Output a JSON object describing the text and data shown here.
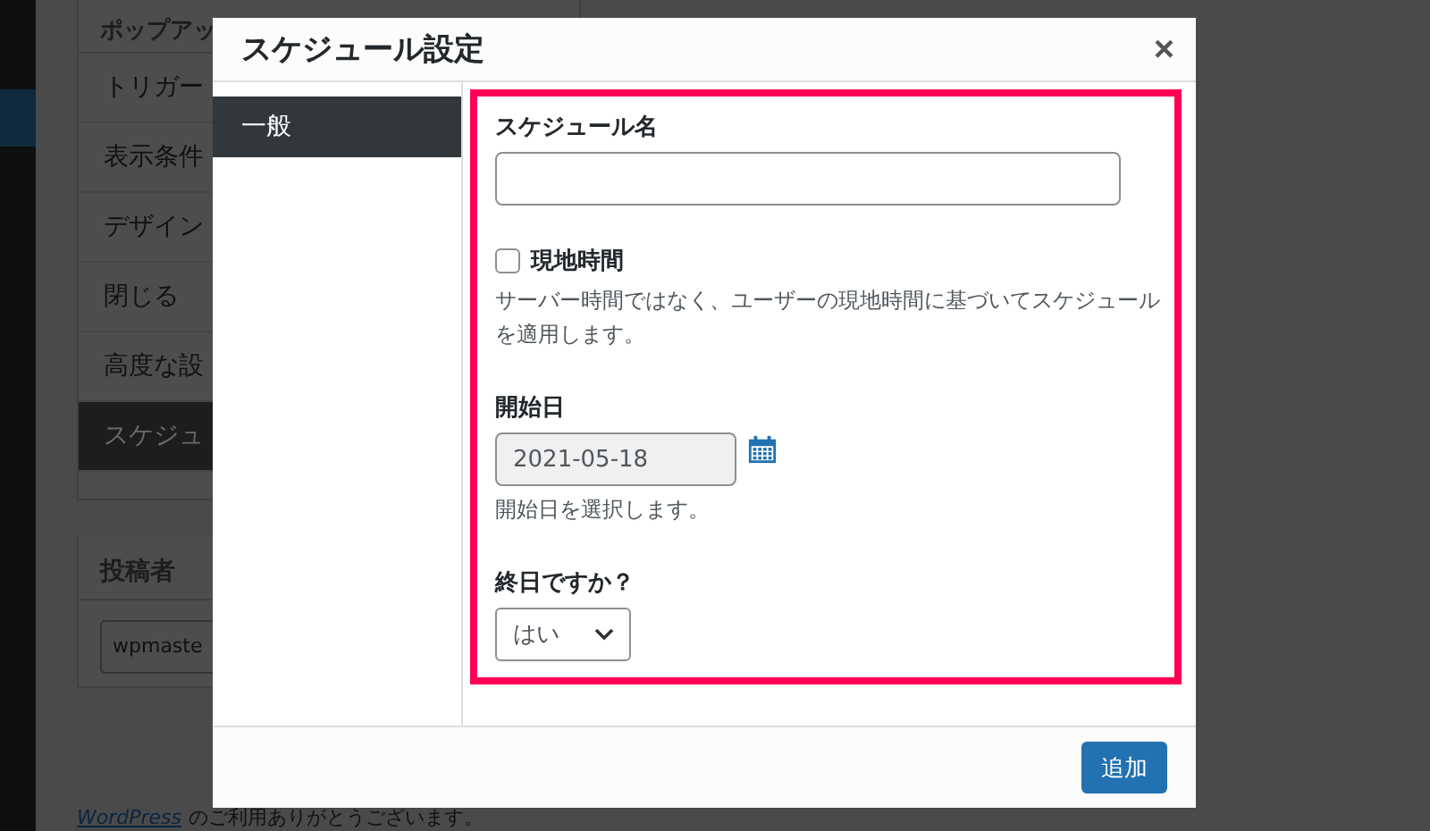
{
  "background": {
    "panel_title": "ポップアッ",
    "menu_items": [
      {
        "label": "トリガー",
        "selected": false
      },
      {
        "label": "表示条件",
        "selected": false
      },
      {
        "label": "デザイン",
        "selected": false
      },
      {
        "label": "閉じる",
        "selected": false
      },
      {
        "label": "高度な設",
        "selected": false
      },
      {
        "label": "スケジュ",
        "selected": true
      }
    ],
    "author_title": "投稿者",
    "author_value": "wpmaste",
    "footer_link": "WordPress",
    "footer_text": "のご利用ありがとうございます。"
  },
  "dialog": {
    "title": "スケジュール設定",
    "close": "×",
    "tabs": [
      {
        "label": "一般",
        "selected": true
      }
    ],
    "fields": [
      {
        "kind": "text",
        "label": "スケジュール名"
      },
      {
        "kind": "checkbox",
        "label": "現地時間",
        "checked": false,
        "help": "サーバー時間ではなく、ユーザーの現地時間に基づいてスケジュールを適用します。"
      },
      {
        "kind": "date",
        "label": "開始日",
        "value": "2021-05-18",
        "help": "開始日を選択します。"
      },
      {
        "kind": "select",
        "label": "終日ですか？",
        "value": "はい"
      }
    ],
    "buttons": [
      "追加"
    ]
  }
}
